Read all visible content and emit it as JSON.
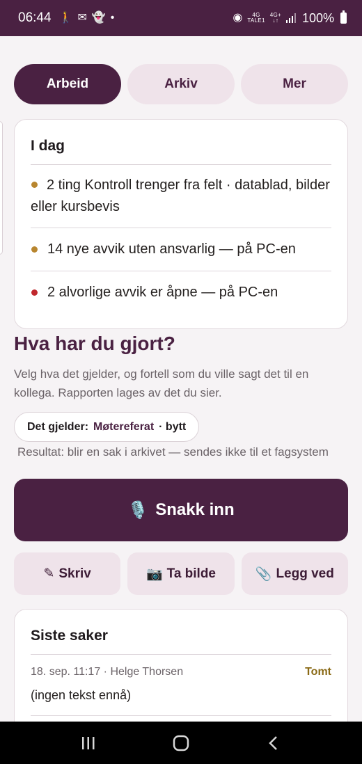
{
  "status_bar": {
    "time": "06:44",
    "network_top": "4G",
    "network_bottom": "TALE1",
    "network2_top": "4G+",
    "battery": "100%"
  },
  "tabs": [
    {
      "label": "Arbeid",
      "active": true
    },
    {
      "label": "Arkiv",
      "active": false
    },
    {
      "label": "Mer",
      "active": false
    }
  ],
  "today": {
    "title": "I dag",
    "items": [
      {
        "text": "2 ting Kontroll trenger fra felt · datablad, bilder eller kursbevis",
        "color": "#b8862f"
      },
      {
        "text": "14 nye avvik uten ansvarlig — på PC-en",
        "color": "#b8862f"
      },
      {
        "text": "2 alvorlige avvik er åpne — på PC-en",
        "color": "#c0282d"
      }
    ]
  },
  "compose": {
    "heading": "Hva har du gjort?",
    "intro": "Velg hva det gjelder, og fortell som du ville sagt det til en kollega. Rapporten lages av det du sier.",
    "chip_label": "Det gjelder:",
    "chip_value": "Møtereferat",
    "chip_action": "· bytt",
    "result": "Resultat: blir en sak i arkivet — sendes ikke til et fagsystem",
    "speak_icon": "🎙️",
    "speak_label": "Snakk inn",
    "actions": [
      {
        "icon": "✎",
        "label": "Skriv"
      },
      {
        "icon": "📷",
        "label": "Ta bilde"
      },
      {
        "icon": "📎",
        "label": "Legg ved"
      }
    ]
  },
  "recent": {
    "title": "Siste saker",
    "cases": [
      {
        "meta": "18. sep. 11:17 · Helge Thorsen",
        "status": "Tomt",
        "text": "(ingen tekst ennå)"
      }
    ]
  },
  "colors": {
    "brand": "#4a2142",
    "tab_bg": "#efe3ea",
    "warning": "#b8862f",
    "danger": "#c0282d",
    "status_empty": "#8a6a16"
  }
}
